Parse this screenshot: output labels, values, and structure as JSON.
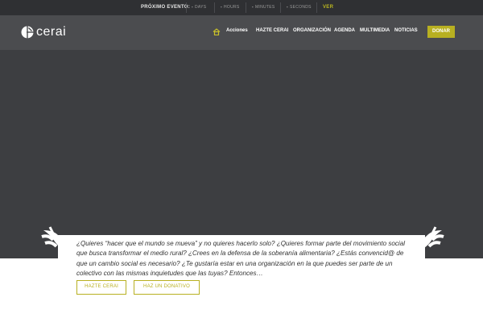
{
  "countdown": {
    "label": "PRÓXIMO EVENTO:",
    "items": [
      {
        "value": "-",
        "unit": "DAYS"
      },
      {
        "value": "-",
        "unit": "HOURS"
      },
      {
        "value": "-",
        "unit": "MINUTES"
      },
      {
        "value": "-",
        "unit": "SECONDS"
      }
    ],
    "link": "VER"
  },
  "logo": {
    "text": "cerai",
    "icon": "cerai-logo-icon"
  },
  "nav": {
    "home_icon": "home-icon",
    "items": [
      "Acciones",
      "HAZTE CERAI",
      "ORGANIZACIÓN",
      "AGENDA",
      "MULTIMEDIA",
      "NOTICIAS"
    ],
    "donate": "DONAR"
  },
  "intro": {
    "text": "¿Quieres “hacer que el mundo se mueva” y no quieres hacerlo solo? ¿Quieres formar parte del movimiento social que busca transformar el medio rural? ¿Crees en la defensa de la soberanía alimentaria? ¿Estás convencid@ de que un cambio social es necesario? ¿Te gustaría estar en una organización en la que puedes ser parte de un colectivo con las mismas inquietudes que las tuyas? Entonces…"
  },
  "buttons": {
    "join": "HAZTE CERAI",
    "donate": "HAZ UN DONATIVO"
  },
  "colors": {
    "accent": "#b8b021",
    "topbar": "#2f3033",
    "header": "#4b4c4f",
    "hero": "#3d3e41"
  }
}
